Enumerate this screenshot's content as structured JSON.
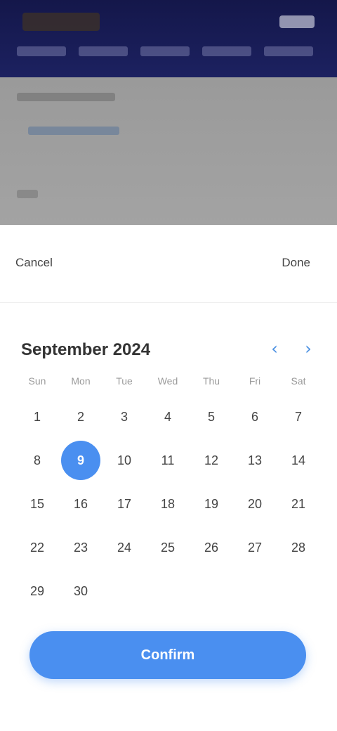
{
  "background": {
    "header_color": "#1c2160",
    "content_color": "#9a9a9a"
  },
  "sheet": {
    "cancel_label": "Cancel",
    "done_label": "Done",
    "month_label": "September 2024",
    "prev_icon": "chevron-left-icon",
    "next_icon": "chevron-right-icon",
    "weekdays": [
      "Sun",
      "Mon",
      "Tue",
      "Wed",
      "Thu",
      "Fri",
      "Sat"
    ],
    "leading_blanks": 0,
    "days": [
      "1",
      "2",
      "3",
      "4",
      "5",
      "6",
      "7",
      "8",
      "9",
      "10",
      "11",
      "12",
      "13",
      "14",
      "15",
      "16",
      "17",
      "18",
      "19",
      "20",
      "21",
      "22",
      "23",
      "24",
      "25",
      "26",
      "27",
      "28",
      "29",
      "30"
    ],
    "selected_day": "9",
    "confirm_label": "Confirm",
    "accent_color": "#4a8ff0"
  }
}
